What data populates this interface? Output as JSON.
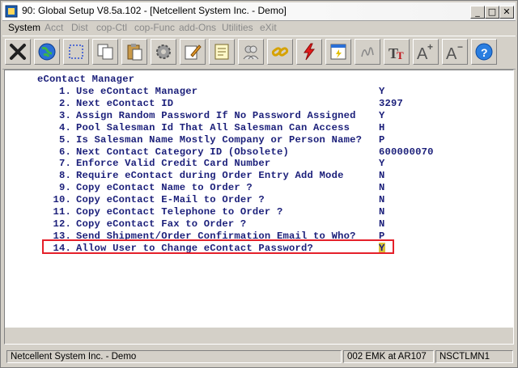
{
  "window": {
    "title": "90: Global Setup V8.5a.102 - [Netcellent System Inc. - Demo]",
    "controls": {
      "minimize": "_",
      "maximize": "□",
      "close": "✕"
    }
  },
  "menu": [
    {
      "label": "System",
      "enabled": true
    },
    {
      "label": "Acct",
      "enabled": false
    },
    {
      "label": "Dist",
      "enabled": false
    },
    {
      "label": "cop-Ctl",
      "enabled": false
    },
    {
      "label": "cop-Func",
      "enabled": false
    },
    {
      "label": "add-Ons",
      "enabled": false
    },
    {
      "label": "Utilities",
      "enabled": false
    },
    {
      "label": "eXit",
      "enabled": false
    }
  ],
  "toolbar_icons": [
    "exit-icon",
    "globe-icon",
    "select-icon",
    "copy-icon",
    "paste-icon",
    "settings-icon",
    "edit-icon",
    "notes-icon",
    "users-icon",
    "link-icon",
    "lightning-icon",
    "image-icon",
    "signature-icon",
    "font-icon",
    "font-increase-icon",
    "font-decrease-icon",
    "help-icon"
  ],
  "form": {
    "heading": "eContact Manager",
    "rows": [
      {
        "num": "1.",
        "label": "Use eContact Manager",
        "value": "Y"
      },
      {
        "num": "2.",
        "label": "Next eContact ID",
        "value": "3297"
      },
      {
        "num": "3.",
        "label": "Assign Random Password If No Password Assigned",
        "value": "Y"
      },
      {
        "num": "4.",
        "label": "Pool Salesman Id That All Salesman Can Access",
        "value": "H"
      },
      {
        "num": "5.",
        "label": "Is Salesman Name Mostly Company or Person Name?",
        "value": "P"
      },
      {
        "num": "6.",
        "label": "Next Contact Category ID (Obsolete)",
        "value": "600000070"
      },
      {
        "num": "7.",
        "label": "Enforce Valid Credit Card Number",
        "value": "Y"
      },
      {
        "num": "8.",
        "label": "Require eContact during Order Entry Add Mode",
        "value": "N"
      },
      {
        "num": "9.",
        "label": "Copy eContact Name to Order ?",
        "value": "N"
      },
      {
        "num": "10.",
        "label": "Copy eContact E-Mail to Order ?",
        "value": "N"
      },
      {
        "num": "11.",
        "label": "Copy eContact Telephone to Order ?",
        "value": "N"
      },
      {
        "num": "12.",
        "label": "Copy eContact Fax to Order ?",
        "value": "N"
      },
      {
        "num": "13.",
        "label": "Send Shipment/Order Confirmation Email to Who?",
        "value": "P"
      },
      {
        "num": "14.",
        "label": "Allow User to Change eContact Password?",
        "value": "Y"
      }
    ]
  },
  "status": {
    "company": "Netcellent System Inc. - Demo",
    "session": "002 EMK at AR107",
    "program": "NSCTLMN1"
  },
  "colors": {
    "form_text": "#1b1f7a",
    "highlight_border": "#e5202a",
    "cursor_bg": "#d9c23a"
  }
}
